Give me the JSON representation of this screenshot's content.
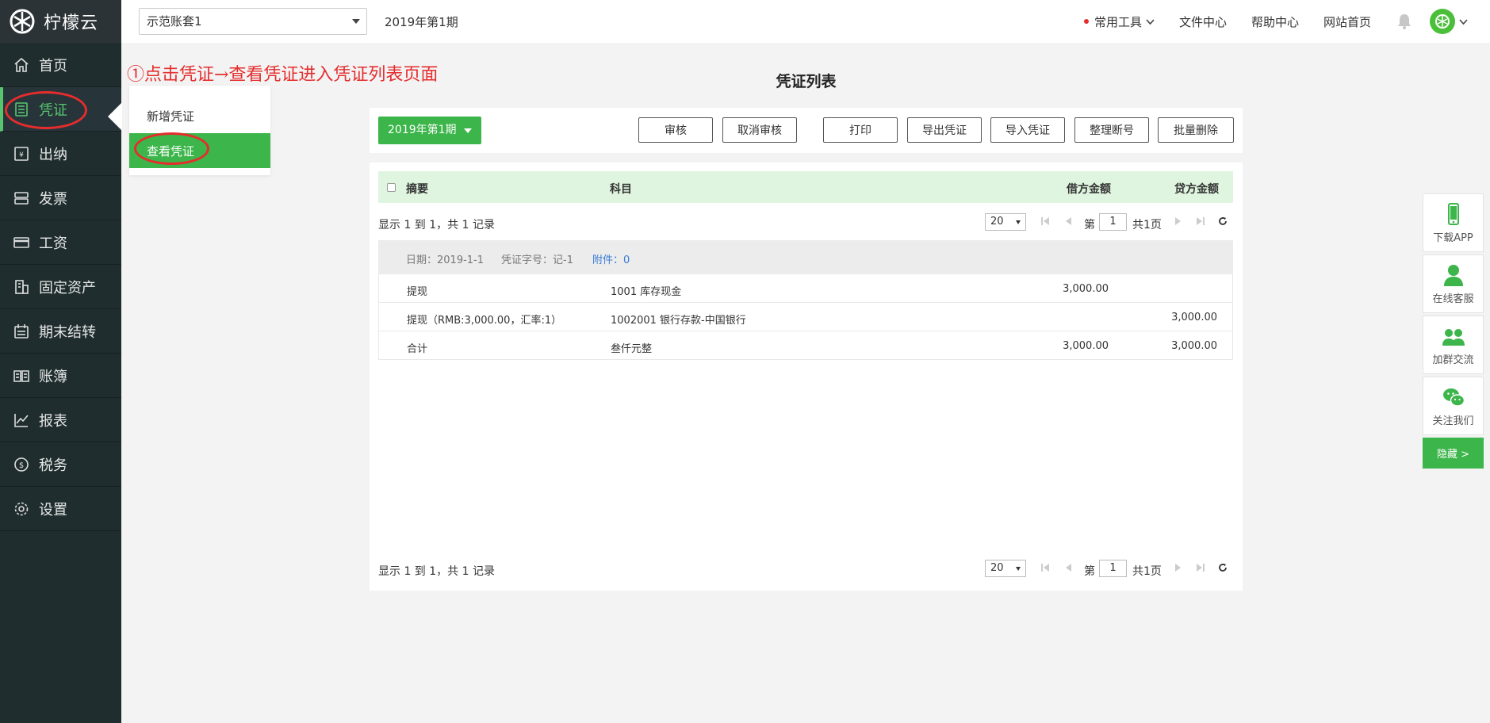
{
  "app": {
    "name": "柠檬云"
  },
  "sidebar": {
    "items": [
      {
        "label": "首页",
        "icon": "home-icon"
      },
      {
        "label": "凭证",
        "icon": "voucher-icon",
        "active": true
      },
      {
        "label": "出纳",
        "icon": "cashier-icon"
      },
      {
        "label": "发票",
        "icon": "invoice-icon"
      },
      {
        "label": "工资",
        "icon": "salary-icon"
      },
      {
        "label": "固定资产",
        "icon": "fixed-asset-icon"
      },
      {
        "label": "期末结转",
        "icon": "calendar-icon"
      },
      {
        "label": "账簿",
        "icon": "ledger-icon"
      },
      {
        "label": "报表",
        "icon": "chart-icon"
      },
      {
        "label": "税务",
        "icon": "tax-icon"
      },
      {
        "label": "设置",
        "icon": "gear-icon"
      }
    ]
  },
  "submenu": {
    "items": [
      "新增凭证",
      "查看凭证"
    ],
    "active_index": 1
  },
  "topbar": {
    "account": "示范账套1",
    "period": "2019年第1期",
    "tools": "常用工具",
    "files": "文件中心",
    "help": "帮助中心",
    "site_home": "网站首页"
  },
  "annotation": "①点击凭证→查看凭证进入凭证列表页面",
  "page_title": "凭证列表",
  "toolbar": {
    "period_button": "2019年第1期",
    "buttons": [
      "审核",
      "取消审核",
      "打印",
      "导出凭证",
      "导入凭证",
      "整理断号",
      "批量删除"
    ]
  },
  "table": {
    "headers": {
      "summary": "摘要",
      "subject": "科目",
      "debit": "借方金额",
      "credit": "贷方金额"
    },
    "pager": {
      "info": "显示 1 到 1，共 1 记录",
      "page_size": "20",
      "page_prefix": "第",
      "page_value": "1",
      "page_total": "共1页"
    },
    "voucher": {
      "date": "日期：2019-1-1",
      "number": "凭证字号：记-1",
      "attachments": "附件：0"
    },
    "rows": [
      {
        "summary": "提现",
        "subject": "1001 库存现金",
        "debit": "3,000.00",
        "credit": ""
      },
      {
        "summary": "提现（RMB:3,000.00，汇率:1）",
        "subject": "1002001 银行存款-中国银行",
        "debit": "",
        "credit": "3,000.00"
      },
      {
        "summary": "合计",
        "subject": "叁仟元整",
        "debit": "3,000.00",
        "credit": "3,000.00"
      }
    ]
  },
  "float_bar": {
    "items": [
      "下载APP",
      "在线客服",
      "加群交流",
      "关注我们"
    ],
    "hide": "隐藏 >"
  },
  "colors": {
    "brand_green": "#3cb54a",
    "sidebar_bg": "#1f2d2f",
    "annotation_red": "#e52d2d"
  }
}
